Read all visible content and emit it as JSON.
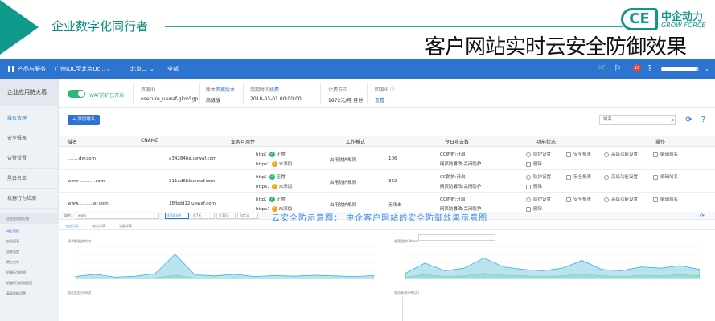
{
  "banner": {
    "slogan": "企业数字化同行者",
    "logo_cn": "中企动力",
    "logo_en": "GROW FORCE",
    "title": "客户网站实时云安全防御效果"
  },
  "topbar": {
    "products": "产品与服务",
    "region": "广州IDC至北京Uc...",
    "zone": "北京二",
    "all": "全部",
    "badge": "16",
    "account": "0.cn"
  },
  "sidebar": {
    "head": "企业应用防火墙",
    "items": [
      "域名管理",
      "安全报表",
      "告警设置",
      "黑白名单",
      "机器行为检测"
    ]
  },
  "info": {
    "waf_label": "WAF防护已开启",
    "resource_id_label": "资源ID",
    "resource_id": "usecure_uewaf-gkm5gp",
    "version_label": "版本",
    "version_link": "变更版本",
    "version": "高级版",
    "expire_label": "到期时间",
    "expire_link": "续费",
    "expire": "2018-03-01 00:00:00",
    "billing_label": "计费方式",
    "billing": "1872元/月 月付",
    "source_ip_label": "回源IP",
    "source_ip_link": "查看"
  },
  "toolbar": {
    "add_label": "添加域名",
    "search_placeholder": "域名"
  },
  "table": {
    "headers": [
      "域名",
      "CNAME",
      "业务可用性",
      "工作模式",
      "今日攻击数",
      "功能状态",
      "操作"
    ],
    "rows": [
      {
        "domain": "........dw.com",
        "cname": "a34284ba.uewaf.com",
        "http": "http：",
        "http_status": "正常",
        "https": "https：",
        "https_status": "未添加",
        "mode": "启用防护规则",
        "attacks": "106",
        "cc": "CC防护:开启",
        "tamper": "网页防篡改:关闭防护"
      },
      {
        "domain": "www ......... .com",
        "cname": "311ad6bf.uewaf.com",
        "http": "http：",
        "http_status": "正常",
        "https": "https：",
        "https_status": "未添加",
        "mode": "启用防护规则",
        "attacks": "322",
        "cc": "CC防护:开启",
        "tamper": "网页防篡改:关闭防护"
      },
      {
        "domain": "www.j.........er.com",
        "cname": "18fbdd12.uewaf.com",
        "http": "http：",
        "http_status": "正常",
        "https": "https：",
        "https_status": "未添加",
        "mode": "启用防护规则",
        "attacks": "无攻击",
        "cc": "CC防护:开启",
        "tamper": "网页防篡改:关闭防护"
      }
    ],
    "actions": [
      "防护设置",
      "安全报表",
      "高级功能设置",
      "编辑域名",
      "删除"
    ]
  },
  "dashboard": {
    "watermark": "云安全防示意图： 中企客户网站的安全防御效果示意图",
    "sidebar_items": [
      "域名管理",
      "安全报表",
      "告警设置",
      "黑白名单",
      "机器行为检测",
      "机器行为检测配置",
      "高级功能设置"
    ],
    "filters": [
      "域名：",
      "www.",
      "近24小时",
      "近7天",
      "近30天",
      "自定义"
    ],
    "tabs": [
      "攻击分析",
      "攻击详情",
      "流量详情"
    ],
    "chart1_title": "请求数量趋势(次)",
    "chart2_title": "带宽趋势(Mbps)",
    "chart3_title": "攻击类型分布(次)",
    "chart4_title": "攻击来源分布(次)"
  },
  "colors": {
    "brand": "#149688",
    "topbar": "#2d73d0",
    "ok": "#2bb673",
    "warn": "#f2a51a"
  },
  "chart_data": [
    {
      "type": "area",
      "title": "请求数量趋势(次)",
      "series": [
        {
          "name": "访问请求数",
          "values": [
            120,
            260,
            80,
            140,
            300,
            1500,
            220,
            160,
            260,
            120,
            180,
            140,
            200,
            160,
            120,
            180
          ]
        },
        {
          "name": "攻击请求数",
          "values": [
            20,
            40,
            20,
            30,
            40,
            200,
            30,
            20,
            40,
            20,
            30,
            20,
            30,
            20,
            20,
            30
          ]
        }
      ],
      "ylim": [
        0,
        2000
      ]
    },
    {
      "type": "area",
      "title": "带宽趋势(Mbps)",
      "series": [
        {
          "name": "入带宽",
          "values": [
            40,
            120,
            60,
            80,
            160,
            90,
            70,
            60,
            80,
            140,
            70,
            60,
            90,
            80,
            100,
            70
          ]
        },
        {
          "name": "出带宽",
          "values": [
            10,
            30,
            15,
            20,
            40,
            25,
            20,
            15,
            20,
            35,
            20,
            15,
            25,
            20,
            30,
            20
          ]
        }
      ],
      "ylim": [
        0,
        250
      ]
    }
  ]
}
